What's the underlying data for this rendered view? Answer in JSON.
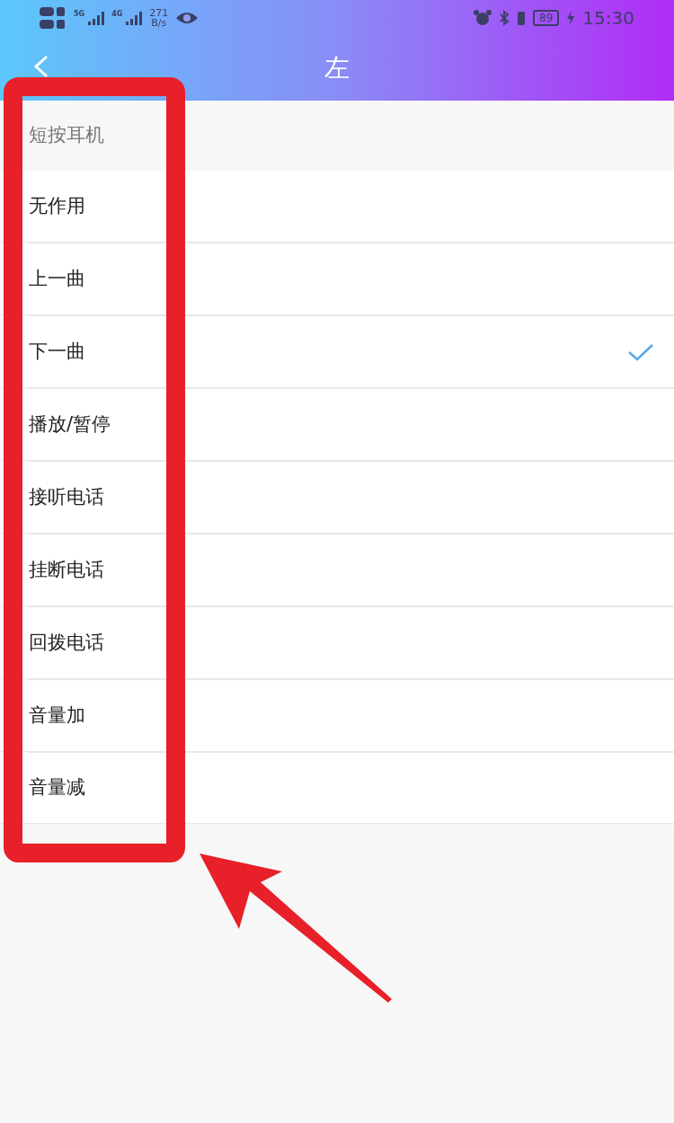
{
  "status_bar": {
    "signal_labels": [
      "5G",
      "4G"
    ],
    "net_speed": "271",
    "net_unit": "B/s",
    "battery": "89",
    "time": "15:30"
  },
  "header": {
    "title": "左"
  },
  "section": {
    "title": "短按耳机"
  },
  "options": [
    {
      "label": "无作用",
      "selected": false
    },
    {
      "label": "上一曲",
      "selected": false
    },
    {
      "label": "下一曲",
      "selected": true
    },
    {
      "label": "播放/暂停",
      "selected": false
    },
    {
      "label": "接听电话",
      "selected": false
    },
    {
      "label": "挂断电话",
      "selected": false
    },
    {
      "label": "回拨电话",
      "selected": false
    },
    {
      "label": "音量加",
      "selected": false
    },
    {
      "label": "音量减",
      "selected": false
    }
  ]
}
